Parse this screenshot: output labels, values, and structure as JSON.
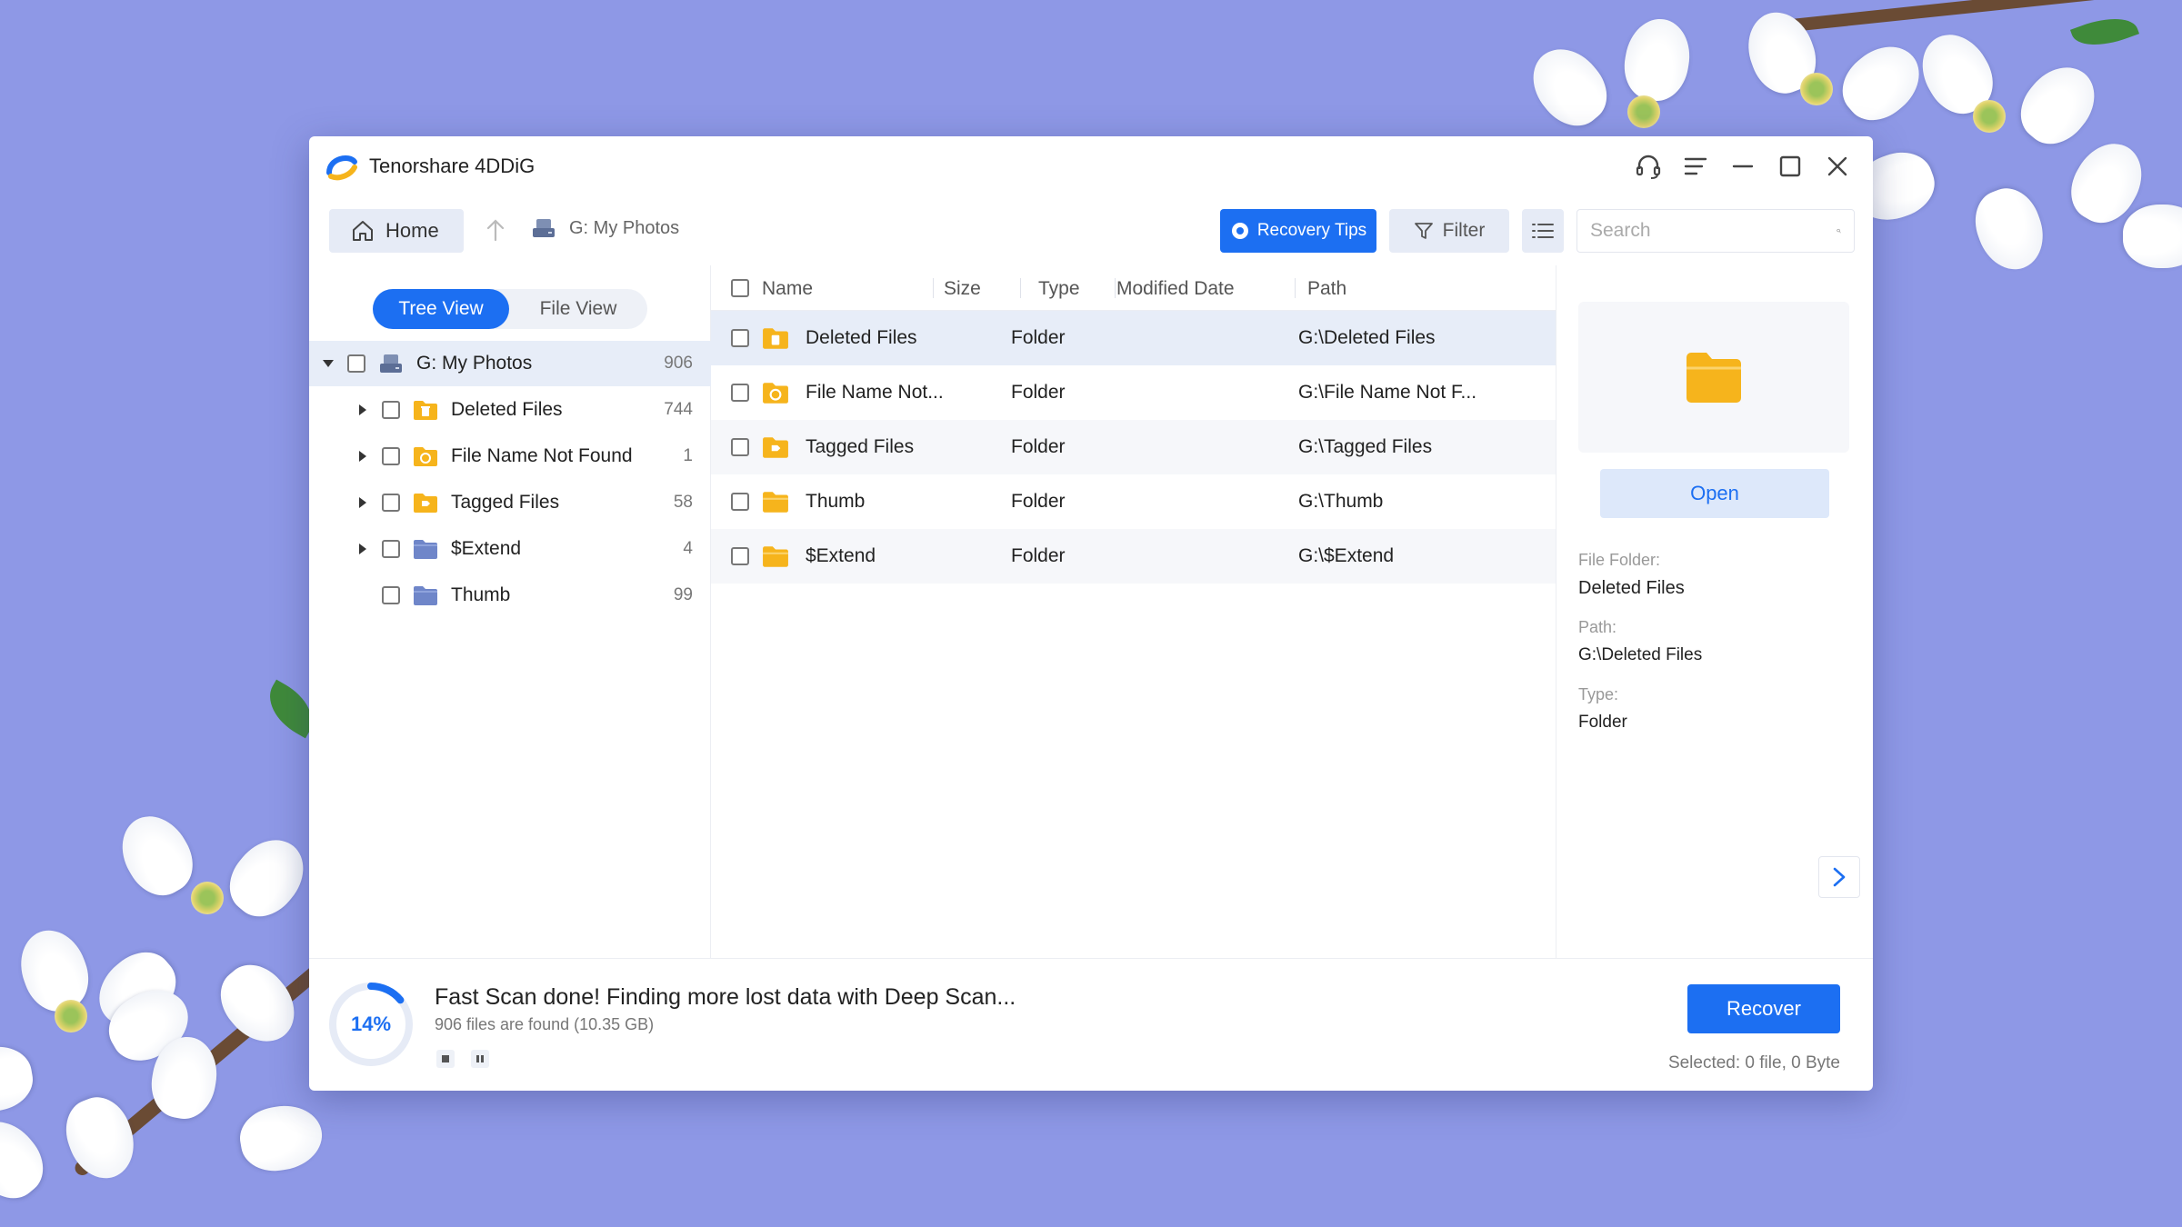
{
  "app": {
    "title": "Tenorshare 4DDiG"
  },
  "toolbar": {
    "home_label": "Home",
    "breadcrumb": "G: My Photos",
    "recovery_tips_label": "Recovery Tips",
    "filter_label": "Filter",
    "search_placeholder": "Search"
  },
  "view_toggle": {
    "tree_view": "Tree View",
    "file_view": "File View"
  },
  "tree": {
    "root": {
      "label": "G: My Photos",
      "count": "906"
    },
    "children": [
      {
        "label": "Deleted Files",
        "count": "744",
        "icon": "deleted-folder-icon"
      },
      {
        "label": "File Name Not Found",
        "count": "1",
        "icon": "unknown-folder-icon"
      },
      {
        "label": "Tagged Files",
        "count": "58",
        "icon": "tagged-folder-icon"
      },
      {
        "label": "$Extend",
        "count": "4",
        "icon": "system-folder-icon"
      },
      {
        "label": "Thumb",
        "count": "99",
        "icon": "system-folder-icon"
      }
    ]
  },
  "table": {
    "columns": {
      "name": "Name",
      "size": "Size",
      "type": "Type",
      "modified": "Modified Date",
      "path": "Path"
    },
    "rows": [
      {
        "name": "Deleted Files",
        "type": "Folder",
        "path": "G:\\Deleted Files"
      },
      {
        "name": "File Name Not...",
        "type": "Folder",
        "path": "G:\\File Name Not F..."
      },
      {
        "name": "Tagged Files",
        "type": "Folder",
        "path": "G:\\Tagged Files"
      },
      {
        "name": "Thumb",
        "type": "Folder",
        "path": "G:\\Thumb"
      },
      {
        "name": "$Extend",
        "type": "Folder",
        "path": "G:\\$Extend"
      }
    ]
  },
  "details": {
    "open_label": "Open",
    "file_folder_label": "File Folder:",
    "file_folder_value": "Deleted Files",
    "path_label": "Path:",
    "path_value": "G:\\Deleted Files",
    "type_label": "Type:",
    "type_value": "Folder"
  },
  "footer": {
    "progress_percent": 14,
    "progress_text": "14%",
    "scan_title": "Fast Scan done! Finding more lost data with Deep Scan...",
    "scan_subtitle": "906 files are found (10.35 GB)",
    "recover_label": "Recover",
    "selected_text": "Selected: 0 file, 0 Byte"
  },
  "colors": {
    "accent": "#1c6ff2",
    "folder": "#f6b41c",
    "background": "#8e98e6"
  }
}
